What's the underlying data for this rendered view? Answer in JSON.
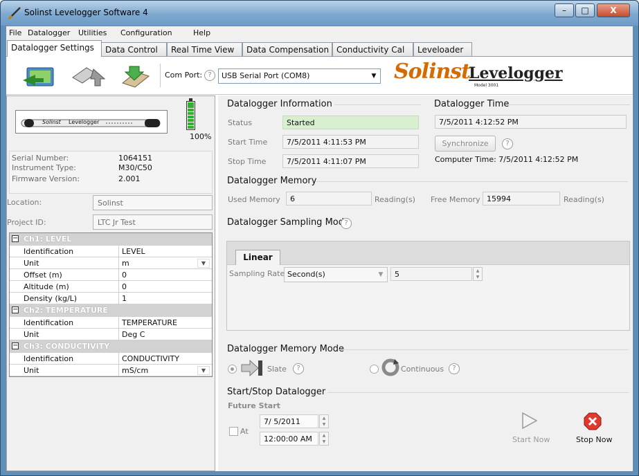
{
  "window": {
    "title": "Solinst Levelogger Software 4",
    "minimize": "–",
    "maximize": "□",
    "close": "X"
  },
  "menu": [
    "File",
    "Datalogger",
    "Utilities",
    "Configuration",
    "Help"
  ],
  "tabs": [
    "Datalogger Settings",
    "Data Control",
    "Real Time View",
    "Data Compensation",
    "Conductivity Cal",
    "Leveloader"
  ],
  "toolbar": {
    "com_port_label": "Com Port:",
    "com_port_value": "USB Serial Port (COM8)",
    "help": "?",
    "logo_solinst": "Solinst",
    "logo_levelogger": "Levelogger",
    "logo_model": "Model 3001"
  },
  "device": {
    "image_brand": "Solinst",
    "image_model": "Levelogger",
    "battery_percent": "100%",
    "battery_level": 1.0,
    "serial_label": "Serial Number:",
    "serial_value": "1064151",
    "instrument_label": "Instrument Type:",
    "instrument_value": "M30/C50",
    "firmware_label": "Firmware Version:",
    "firmware_value": "2.001",
    "location_label": "Location:",
    "location_value": "Solinst",
    "project_label": "Project ID:",
    "project_value": "LTC Jr Test"
  },
  "channels": [
    {
      "header": "Ch1: LEVEL",
      "rows": [
        {
          "name": "Identification",
          "value": "LEVEL",
          "dropdown": false
        },
        {
          "name": "Unit",
          "value": "m",
          "dropdown": true
        },
        {
          "name": "Offset (m)",
          "value": "0",
          "dropdown": false
        },
        {
          "name": "Altitude (m)",
          "value": "0",
          "dropdown": false
        },
        {
          "name": "Density (kg/L)",
          "value": "1",
          "dropdown": false
        }
      ]
    },
    {
      "header": "Ch2: TEMPERATURE",
      "rows": [
        {
          "name": "Identification",
          "value": "TEMPERATURE",
          "dropdown": false
        },
        {
          "name": "Unit",
          "value": "Deg C",
          "dropdown": false
        }
      ]
    },
    {
      "header": "Ch3: CONDUCTIVITY",
      "rows": [
        {
          "name": "Identification",
          "value": "CONDUCTIVITY",
          "dropdown": false
        },
        {
          "name": "Unit",
          "value": "mS/cm",
          "dropdown": true
        }
      ]
    }
  ],
  "info": {
    "title": "Datalogger Information",
    "status_label": "Status",
    "status_value": "Started",
    "start_label": "Start Time",
    "start_value": "7/5/2011 4:11:53 PM",
    "stop_label": "Stop Time",
    "stop_value": "7/5/2011 4:11:07 PM"
  },
  "time": {
    "title": "Datalogger Time",
    "value": "7/5/2011 4:12:52 PM",
    "sync_label": "Synchronize",
    "computer_time": "Computer Time: 7/5/2011 4:12:52 PM"
  },
  "memory": {
    "title": "Datalogger Memory",
    "used_label": "Used Memory",
    "used_value": "6",
    "readings_label": "Reading(s)",
    "free_label": "Free Memory",
    "free_value": "15994"
  },
  "sampling": {
    "title": "Datalogger Sampling Mode",
    "tab_label": "Linear",
    "rate_label": "Sampling Rate",
    "unit_value": "Second(s)",
    "rate_value": "5"
  },
  "memory_mode": {
    "title": "Datalogger Memory Mode",
    "slate_label": "Slate",
    "continuous_label": "Continuous"
  },
  "start_stop": {
    "title": "Start/Stop Datalogger",
    "future_start": "Future Start",
    "at_label": "At",
    "date_value": "7/ 5/2011",
    "time_value": "12:00:00 AM",
    "start_now": "Start Now",
    "stop_now": "Stop Now"
  }
}
